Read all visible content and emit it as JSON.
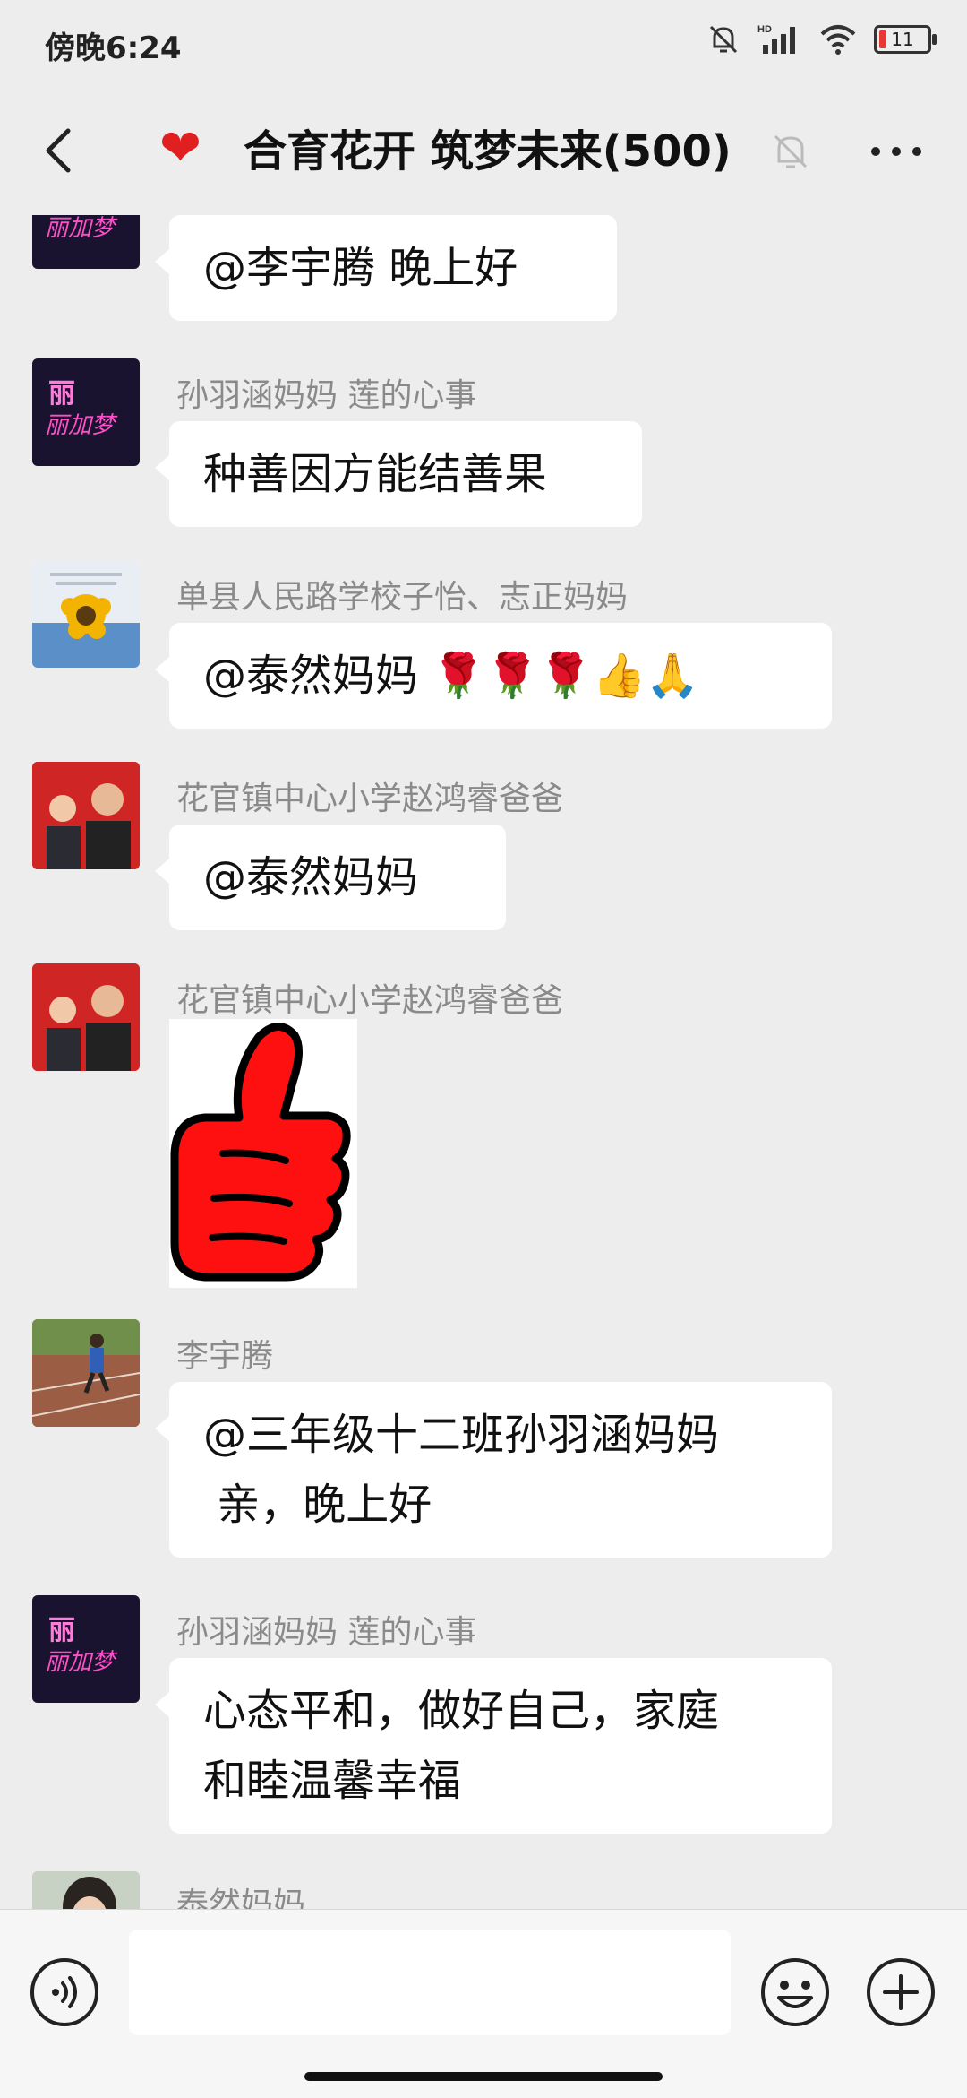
{
  "status_bar": {
    "time": "傍晚6:24",
    "battery": "11",
    "network": "HD"
  },
  "header": {
    "title": "合育花开 筑梦未来(500)",
    "title_icon": "heart"
  },
  "messages": [
    {
      "sender": "",
      "text": "@李宇腾  晚上好",
      "avatar": "li-logo"
    },
    {
      "sender": "孙羽涵妈妈  莲的心事",
      "text": "种善因方能结善果",
      "avatar": "li-logo"
    },
    {
      "sender": "单县人民路学校子怡、志正妈妈",
      "text": "@泰然妈妈 🌹🌹🌹👍🙏",
      "avatar": "sunflower"
    },
    {
      "sender": "花官镇中心小学赵鸿睿爸爸",
      "text": "@泰然妈妈",
      "avatar": "family-red"
    },
    {
      "sender": "花官镇中心小学赵鸿睿爸爸",
      "sticker": "thumbs-up",
      "avatar": "family-red"
    },
    {
      "sender": "李宇腾",
      "line1": "@三年级十二班孙羽涵妈妈",
      "line2": " 亲，晚上好",
      "avatar": "track"
    },
    {
      "sender": "孙羽涵妈妈  莲的心事",
      "line1": "心态平和，做好自己，家庭",
      "line2": "和睦温馨幸福",
      "avatar": "li-logo"
    },
    {
      "sender": "泰然妈妈",
      "avatar": "portrait"
    }
  ],
  "avatar_text": {
    "li_main": "丽",
    "li_script": "丽加梦"
  },
  "composer": {
    "input_value": ""
  }
}
